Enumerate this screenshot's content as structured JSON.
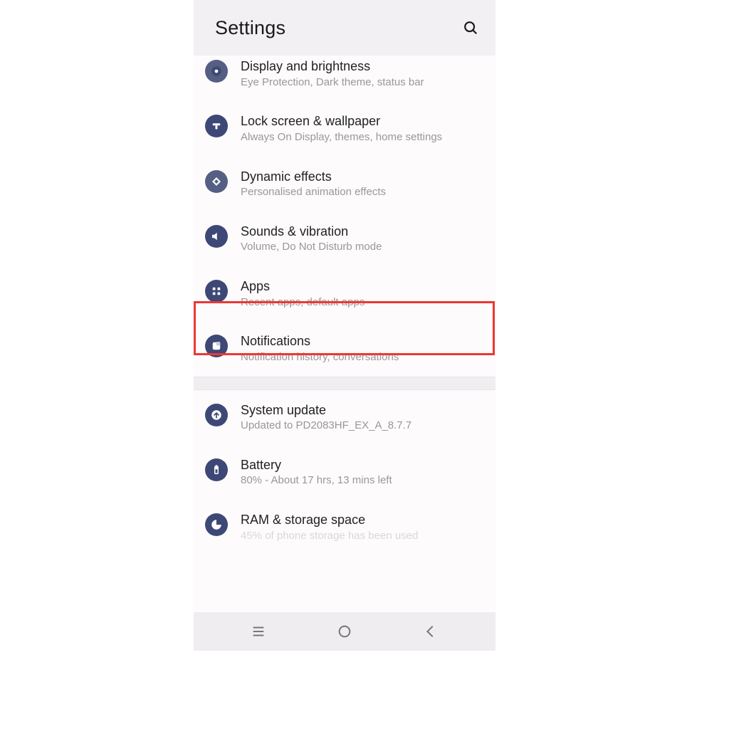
{
  "header": {
    "title": "Settings"
  },
  "highlight_index": 4,
  "groups": [
    {
      "items": [
        {
          "icon": "display-icon",
          "title": "Display and brightness",
          "subtitle": "Eye Protection, Dark theme, status bar"
        },
        {
          "icon": "lock-icon",
          "title": "Lock screen & wallpaper",
          "subtitle": "Always On Display, themes, home settings"
        },
        {
          "icon": "effects-icon",
          "title": "Dynamic effects",
          "subtitle": "Personalised animation effects"
        },
        {
          "icon": "sound-icon",
          "title": "Sounds & vibration",
          "subtitle": "Volume, Do Not Disturb mode"
        },
        {
          "icon": "apps-icon",
          "title": "Apps",
          "subtitle": "Recent apps, default apps"
        },
        {
          "icon": "notif-icon",
          "title": "Notifications",
          "subtitle": "Notification history, conversations"
        }
      ]
    },
    {
      "items": [
        {
          "icon": "update-icon",
          "title": "System update",
          "subtitle": "Updated to PD2083HF_EX_A_8.7.7"
        },
        {
          "icon": "battery-icon",
          "title": "Battery",
          "subtitle": "80% - About 17 hrs, 13 mins left"
        },
        {
          "icon": "storage-icon",
          "title": "RAM & storage space",
          "subtitle": "45% of phone storage has been used"
        }
      ]
    }
  ]
}
